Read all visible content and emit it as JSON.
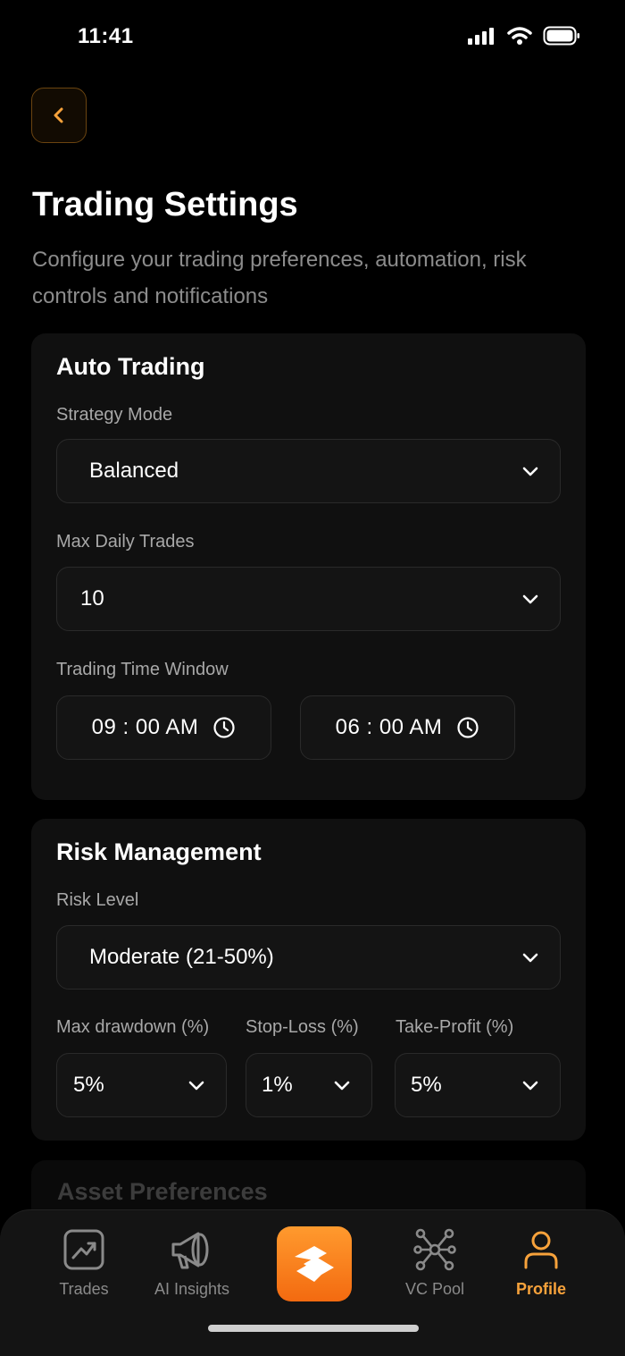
{
  "status": {
    "time": "11:41"
  },
  "header": {
    "title": "Trading Settings",
    "subtitle": "Configure your trading preferences, automation, risk controls and notifications"
  },
  "auto_trading": {
    "title": "Auto Trading",
    "strategy_label": "Strategy Mode",
    "strategy_value": "Balanced",
    "max_trades_label": "Max Daily Trades",
    "max_trades_value": "10",
    "window_label": "Trading Time Window",
    "window_start": "09 : 00 AM",
    "window_end": "06 : 00 AM"
  },
  "risk": {
    "title": "Risk Management",
    "level_label": "Risk Level",
    "level_value": "Moderate (21-50%)",
    "drawdown_label": "Max drawdown (%)",
    "drawdown_value": "5%",
    "stoploss_label": "Stop-Loss (%)",
    "stoploss_value": "1%",
    "takeprofit_label": "Take-Profit (%)",
    "takeprofit_value": "5%"
  },
  "asset_preferences": {
    "title": "Asset Preferences"
  },
  "tabbar": {
    "tabs": [
      {
        "label": "Trades",
        "icon": "trend-chart-icon"
      },
      {
        "label": "AI Insights",
        "icon": "megaphone-icon"
      },
      {
        "label": "",
        "icon": "app-logo-icon"
      },
      {
        "label": "VC Pool",
        "icon": "network-icon"
      },
      {
        "label": "Profile",
        "icon": "user-icon"
      }
    ],
    "active": "Profile"
  },
  "colors": {
    "accent": "#f7a23b",
    "background": "#000000",
    "card": "#101010"
  }
}
